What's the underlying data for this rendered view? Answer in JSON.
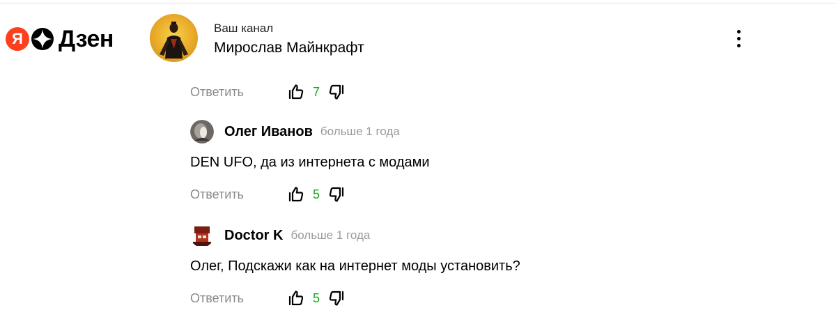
{
  "logo": {
    "ya_letter": "Я",
    "brand": "Дзен"
  },
  "channel": {
    "caption": "Ваш канал",
    "name": "Мирослав Майнкрафт"
  },
  "thread": {
    "top_actions": {
      "reply_label": "Ответить",
      "likes": "7"
    },
    "comments": [
      {
        "author": "Олег Иванов",
        "time": "больше 1 года",
        "text": "DEN UFO, да из интернета с модами",
        "reply_label": "Ответить",
        "likes": "5"
      },
      {
        "author": "Doctor K",
        "time": "больше 1 года",
        "text": "Олег, Подскажи как на интернет моды установить?",
        "reply_label": "Ответить",
        "likes": "5"
      }
    ]
  },
  "colors": {
    "accent_red": "#fc3f1d",
    "like_count_green": "#18a51b",
    "muted_text": "#8a8a8a"
  },
  "icons": [
    "more-vertical-icon",
    "thumbs-up-icon",
    "thumbs-down-icon"
  ]
}
